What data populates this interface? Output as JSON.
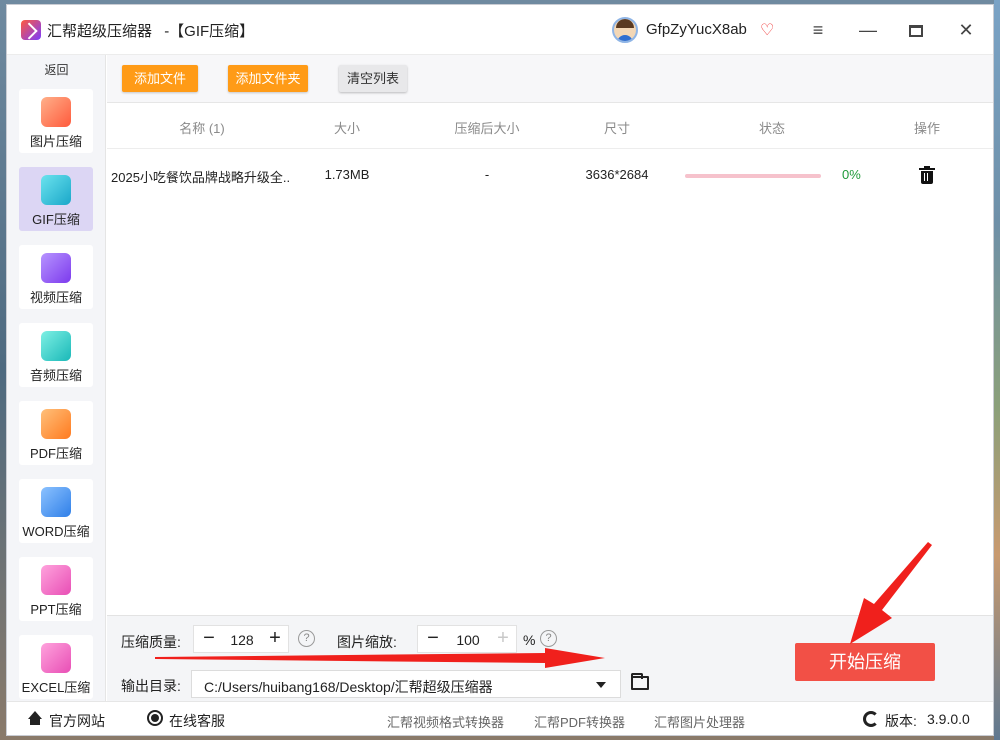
{
  "window": {
    "app_name": "汇帮超级压缩器",
    "title_suffix": "-【GIF压缩】",
    "user_name": "GfpZyYucX8ab"
  },
  "sidebar": {
    "back_label": "返回",
    "items": [
      {
        "label": "图片压缩",
        "icon": "image-icon",
        "color": "#ff7a4d"
      },
      {
        "label": "GIF压缩",
        "icon": "gif-icon",
        "color": "#25c3d6",
        "active": true
      },
      {
        "label": "视频压缩",
        "icon": "video-icon",
        "color": "#8b5cf6"
      },
      {
        "label": "音频压缩",
        "icon": "audio-icon",
        "color": "#22c6c0"
      },
      {
        "label": "PDF压缩",
        "icon": "pdf-icon",
        "color": "#ff8a3c"
      },
      {
        "label": "WORD压缩",
        "icon": "word-icon",
        "color": "#3b8df0"
      },
      {
        "label": "PPT压缩",
        "icon": "ppt-icon",
        "color": "#f062c0"
      },
      {
        "label": "EXCEL压缩",
        "icon": "excel-icon",
        "color": "#f062c0"
      }
    ]
  },
  "toolbar": {
    "add_file": "添加文件",
    "add_folder": "添加文件夹",
    "clear_list": "清空列表"
  },
  "table": {
    "headers": {
      "name": "名称 (1)",
      "size": "大小",
      "compressed_size": "压缩后大小",
      "dimensions": "尺寸",
      "status": "状态",
      "action": "操作"
    },
    "rows": [
      {
        "name": "2025小吃餐饮品牌战略升级全...",
        "size": "1.73MB",
        "compressed_size": "-",
        "dimensions": "3636*2684",
        "progress": 0,
        "progress_text": "0%"
      }
    ]
  },
  "settings": {
    "quality_label": "压缩质量:",
    "quality_value": "128",
    "scale_label": "图片缩放:",
    "scale_value": "100",
    "scale_unit": "%",
    "output_label": "输出目录:",
    "output_path": "C:/Users/huibang168/Desktop/汇帮超级压缩器",
    "start_button": "开始压缩"
  },
  "statusbar": {
    "website": "官方网站",
    "support": "在线客服",
    "link_video": "汇帮视频格式转换器",
    "link_pdf": "汇帮PDF转换器",
    "link_image": "汇帮图片处理器",
    "version_label": "版本:",
    "version": "3.9.0.0"
  },
  "colors": {
    "orange_button": "#ff9b17",
    "start_button": "#f25046",
    "active_nav": "#dcd6f4",
    "progress_track": "#f6c2cc",
    "percent_text": "#1f9a3a",
    "annotation_arrow": "#f0201c"
  }
}
